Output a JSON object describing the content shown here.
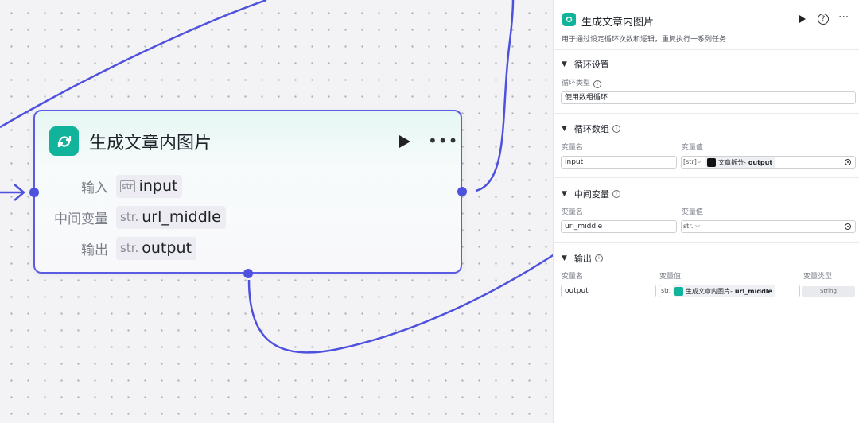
{
  "node": {
    "title": "生成文章内图片",
    "rows": [
      {
        "label": "输入",
        "type": "str",
        "value": "input"
      },
      {
        "label": "中间变量",
        "type": "str.",
        "value": "url_middle"
      },
      {
        "label": "输出",
        "type": "str.",
        "value": "output"
      }
    ]
  },
  "panel": {
    "title": "生成文章内图片",
    "description": "用于通过设定循环次数和逻辑，重复执行一系列任务",
    "loop_settings": {
      "heading": "循环设置",
      "type_label": "循环类型",
      "type_value": "使用数组循环"
    },
    "loop_array": {
      "heading": "循环数组",
      "col_name": "变量名",
      "col_value": "变量值",
      "var_name": "input",
      "type_tag": "[str]",
      "ref_source": "文章拆分",
      "ref_sep": " - ",
      "ref_field": "output"
    },
    "middle_var": {
      "heading": "中间变量",
      "col_name": "变量名",
      "col_value": "变量值",
      "var_name": "url_middle",
      "type_tag": "str."
    },
    "output": {
      "heading": "输出",
      "col_name": "变量名",
      "col_value": "变量值",
      "col_type": "变量类型",
      "var_name": "output",
      "type_tag": "str.",
      "ref_source": "生成文章内图片",
      "ref_sep": " - ",
      "ref_field": "url_middle",
      "var_type": "String"
    }
  },
  "colors": {
    "accent": "#4e51dd",
    "node_icon": "#12b39b"
  }
}
